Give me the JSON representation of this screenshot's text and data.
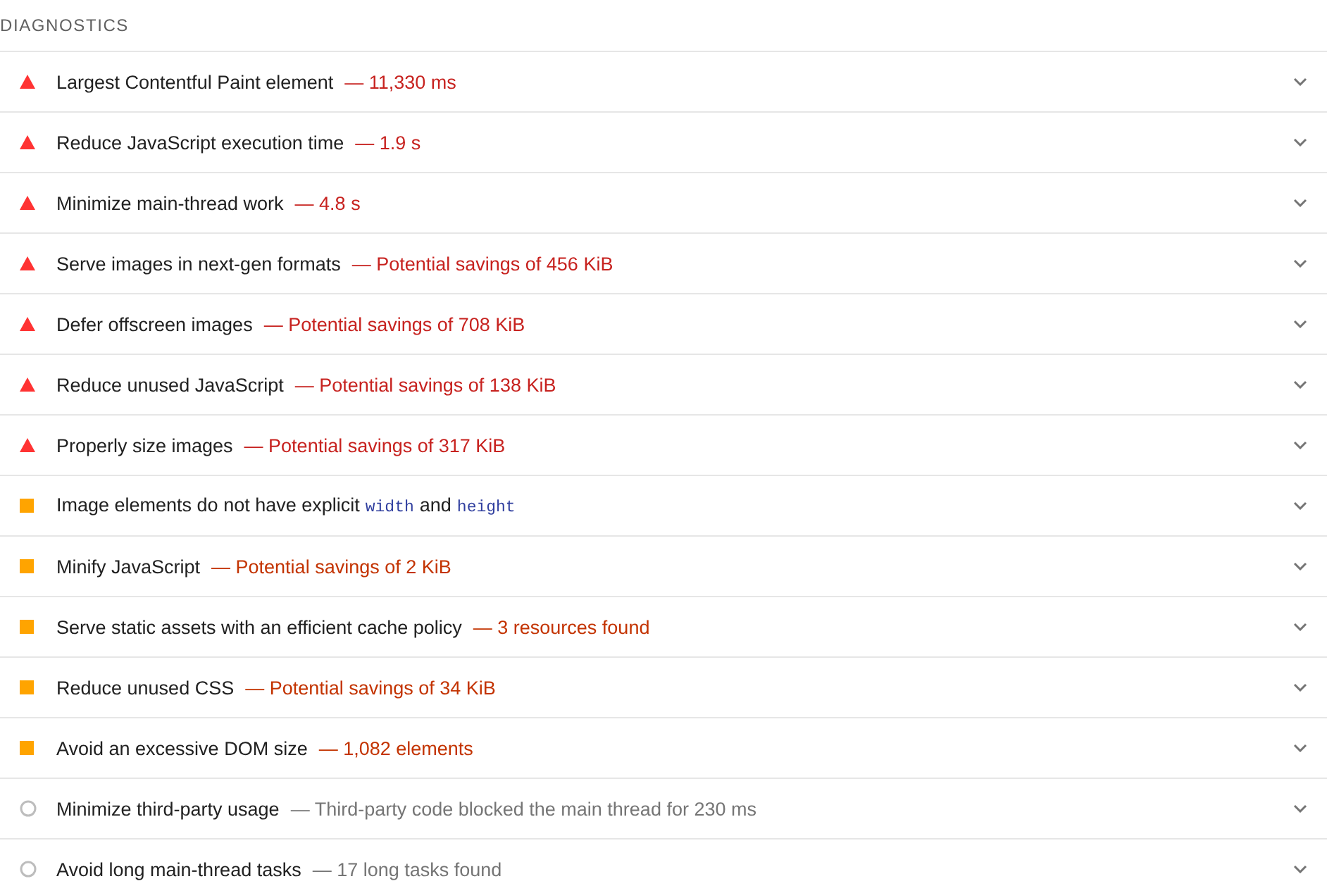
{
  "section_title": "DIAGNOSTICS",
  "audits": [
    {
      "kind": "fail",
      "title": [
        {
          "kind": "text",
          "text": "Largest Contentful Paint element"
        }
      ],
      "display_value": "— 11,330 ms"
    },
    {
      "kind": "fail",
      "title": [
        {
          "kind": "text",
          "text": "Reduce JavaScript execution time"
        }
      ],
      "display_value": "— 1.9 s"
    },
    {
      "kind": "fail",
      "title": [
        {
          "kind": "text",
          "text": "Minimize main-thread work"
        }
      ],
      "display_value": "— 4.8 s"
    },
    {
      "kind": "fail",
      "title": [
        {
          "kind": "text",
          "text": "Serve images in next-gen formats"
        }
      ],
      "display_value": "— Potential savings of 456 KiB"
    },
    {
      "kind": "fail",
      "title": [
        {
          "kind": "text",
          "text": "Defer offscreen images"
        }
      ],
      "display_value": "— Potential savings of 708 KiB"
    },
    {
      "kind": "fail",
      "title": [
        {
          "kind": "text",
          "text": "Reduce unused JavaScript"
        }
      ],
      "display_value": "— Potential savings of 138 KiB"
    },
    {
      "kind": "fail",
      "title": [
        {
          "kind": "text",
          "text": "Properly size images"
        }
      ],
      "display_value": "— Potential savings of 317 KiB"
    },
    {
      "kind": "average",
      "title": [
        {
          "kind": "text",
          "text": "Image elements do not have explicit"
        },
        {
          "kind": "code",
          "text": "width"
        },
        {
          "kind": "text",
          "text": "and"
        },
        {
          "kind": "code",
          "text": "height"
        }
      ]
    },
    {
      "kind": "average",
      "title": [
        {
          "kind": "text",
          "text": "Minify JavaScript"
        }
      ],
      "display_value": "— Potential savings of 2 KiB"
    },
    {
      "kind": "average",
      "title": [
        {
          "kind": "text",
          "text": "Serve static assets with an efficient cache policy"
        }
      ],
      "display_value": "— 3 resources found"
    },
    {
      "kind": "average",
      "title": [
        {
          "kind": "text",
          "text": "Reduce unused CSS"
        }
      ],
      "display_value": "— Potential savings of 34 KiB"
    },
    {
      "kind": "average",
      "title": [
        {
          "kind": "text",
          "text": "Avoid an excessive DOM size"
        }
      ],
      "display_value": "— 1,082 elements"
    },
    {
      "kind": "informative",
      "title": [
        {
          "kind": "text",
          "text": "Minimize third-party usage"
        }
      ],
      "display_value": "— Third-party code blocked the main thread for 230 ms"
    },
    {
      "kind": "informative",
      "title": [
        {
          "kind": "text",
          "text": "Avoid long main-thread tasks"
        }
      ],
      "display_value": "— 17 long tasks found"
    }
  ]
}
